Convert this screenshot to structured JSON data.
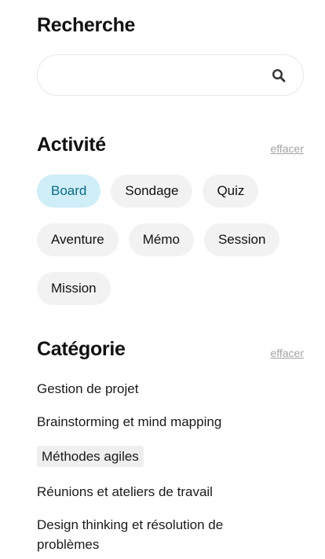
{
  "search": {
    "title": "Recherche",
    "value": "",
    "placeholder": ""
  },
  "activity": {
    "title": "Activité",
    "clear_label": "effacer",
    "chips": [
      {
        "label": "Board",
        "active": true
      },
      {
        "label": "Sondage",
        "active": false
      },
      {
        "label": "Quiz",
        "active": false
      },
      {
        "label": "Aventure",
        "active": false
      },
      {
        "label": "Mémo",
        "active": false
      },
      {
        "label": "Session",
        "active": false
      },
      {
        "label": "Mission",
        "active": false
      }
    ]
  },
  "category": {
    "title": "Catégorie",
    "clear_label": "effacer",
    "items": [
      {
        "label": "Gestion de projet",
        "selected": false
      },
      {
        "label": "Brainstorming et mind mapping",
        "selected": false
      },
      {
        "label": "Méthodes agiles",
        "selected": true
      },
      {
        "label": "Réunions et ateliers de travail",
        "selected": false
      },
      {
        "label": "Design thinking et résolution de problèmes",
        "selected": false
      }
    ]
  },
  "colors": {
    "active_chip_bg": "#cfeef8",
    "active_chip_text": "#0b6a86",
    "chip_bg": "#f2f2f2",
    "clear_link": "#a3a3a3"
  },
  "icons": {
    "search": "search-icon"
  }
}
